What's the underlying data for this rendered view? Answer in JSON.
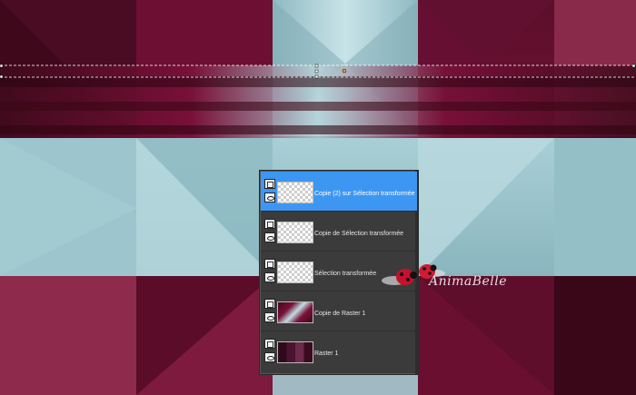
{
  "layers_panel": {
    "layers": [
      {
        "name": "Copie (2) sur Sélection transformée",
        "selected": true,
        "thumbnail": "transparent-checker"
      },
      {
        "name": "Copie de Sélection transformée",
        "selected": false,
        "thumbnail": "transparent-checker"
      },
      {
        "name": "Sélection transformée",
        "selected": false,
        "thumbnail": "transparent-checker"
      },
      {
        "name": "Copie de Raster 1",
        "selected": false,
        "thumbnail": "teal-burgundy-gradient"
      },
      {
        "name": "Raster 1",
        "selected": false,
        "thumbnail": "burgundy-gradient"
      }
    ]
  },
  "watermark": {
    "text": "AnimaBelle"
  },
  "colors": {
    "burgundy": "#7a1038",
    "dark_burgundy": "#3e0a1c",
    "teal": "#9cc5cd",
    "light_teal": "#bfdfe4",
    "panel_bg": "#3b3b3b",
    "selection_blue": "#3d97f2"
  },
  "icons": [
    "eye-icon",
    "layer-group-icon",
    "ladybug-icon"
  ]
}
